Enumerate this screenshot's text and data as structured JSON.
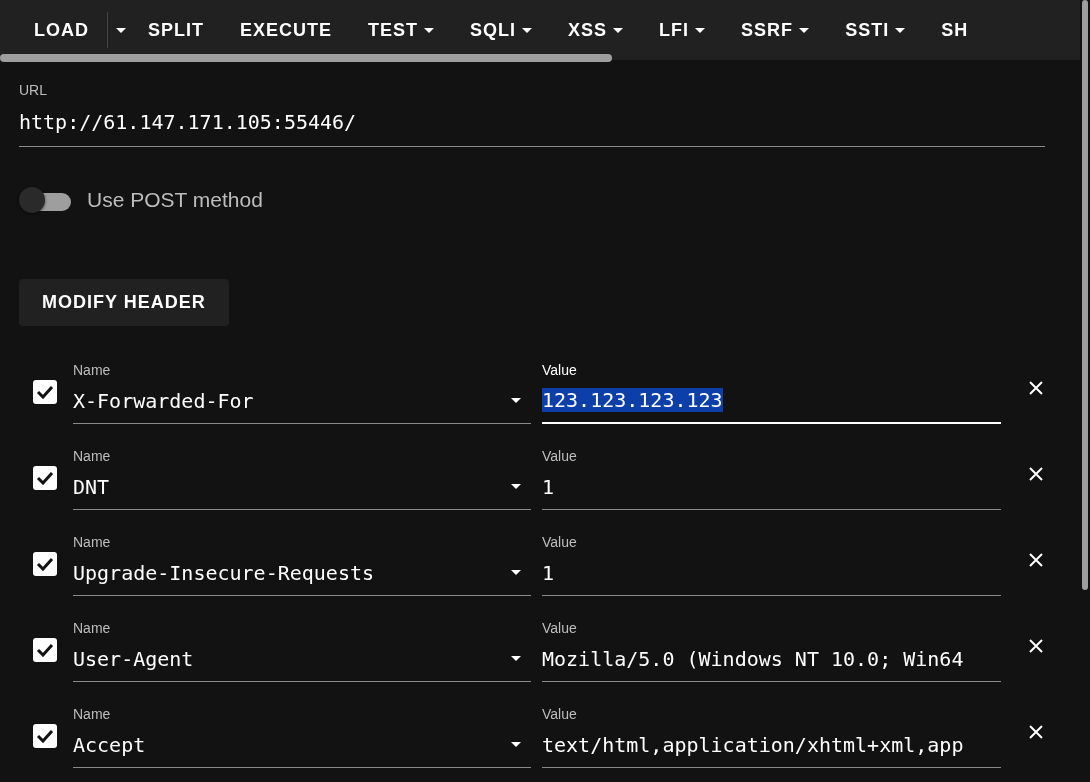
{
  "toolbar": [
    {
      "label": "LOAD",
      "kind": "split"
    },
    {
      "label": "SPLIT",
      "kind": "plain"
    },
    {
      "label": "EXECUTE",
      "kind": "plain"
    },
    {
      "label": "TEST",
      "kind": "menu"
    },
    {
      "label": "SQLI",
      "kind": "menu"
    },
    {
      "label": "XSS",
      "kind": "menu"
    },
    {
      "label": "LFI",
      "kind": "menu"
    },
    {
      "label": "SSRF",
      "kind": "menu"
    },
    {
      "label": "SSTI",
      "kind": "menu"
    },
    {
      "label": "SH",
      "kind": "plain"
    }
  ],
  "url": {
    "label": "URL",
    "value": "http://61.147.171.105:55446/"
  },
  "post_method": {
    "label": "Use POST method",
    "on": false
  },
  "modify_header_button": "MODIFY HEADER",
  "headers": [
    {
      "checked": true,
      "name_label": "Name",
      "name": "X-Forwarded-For",
      "value_label": "Value",
      "value": "123.123.123.123",
      "focused": true
    },
    {
      "checked": true,
      "name_label": "Name",
      "name": "DNT",
      "value_label": "Value",
      "value": "1",
      "focused": false
    },
    {
      "checked": true,
      "name_label": "Name",
      "name": "Upgrade-Insecure-Requests",
      "value_label": "Value",
      "value": "1",
      "focused": false
    },
    {
      "checked": true,
      "name_label": "Name",
      "name": "User-Agent",
      "value_label": "Value",
      "value": "Mozilla/5.0 (Windows NT 10.0; Win64",
      "focused": false
    },
    {
      "checked": true,
      "name_label": "Name",
      "name": "Accept",
      "value_label": "Value",
      "value": "text/html,application/xhtml+xml,app",
      "focused": false
    }
  ]
}
